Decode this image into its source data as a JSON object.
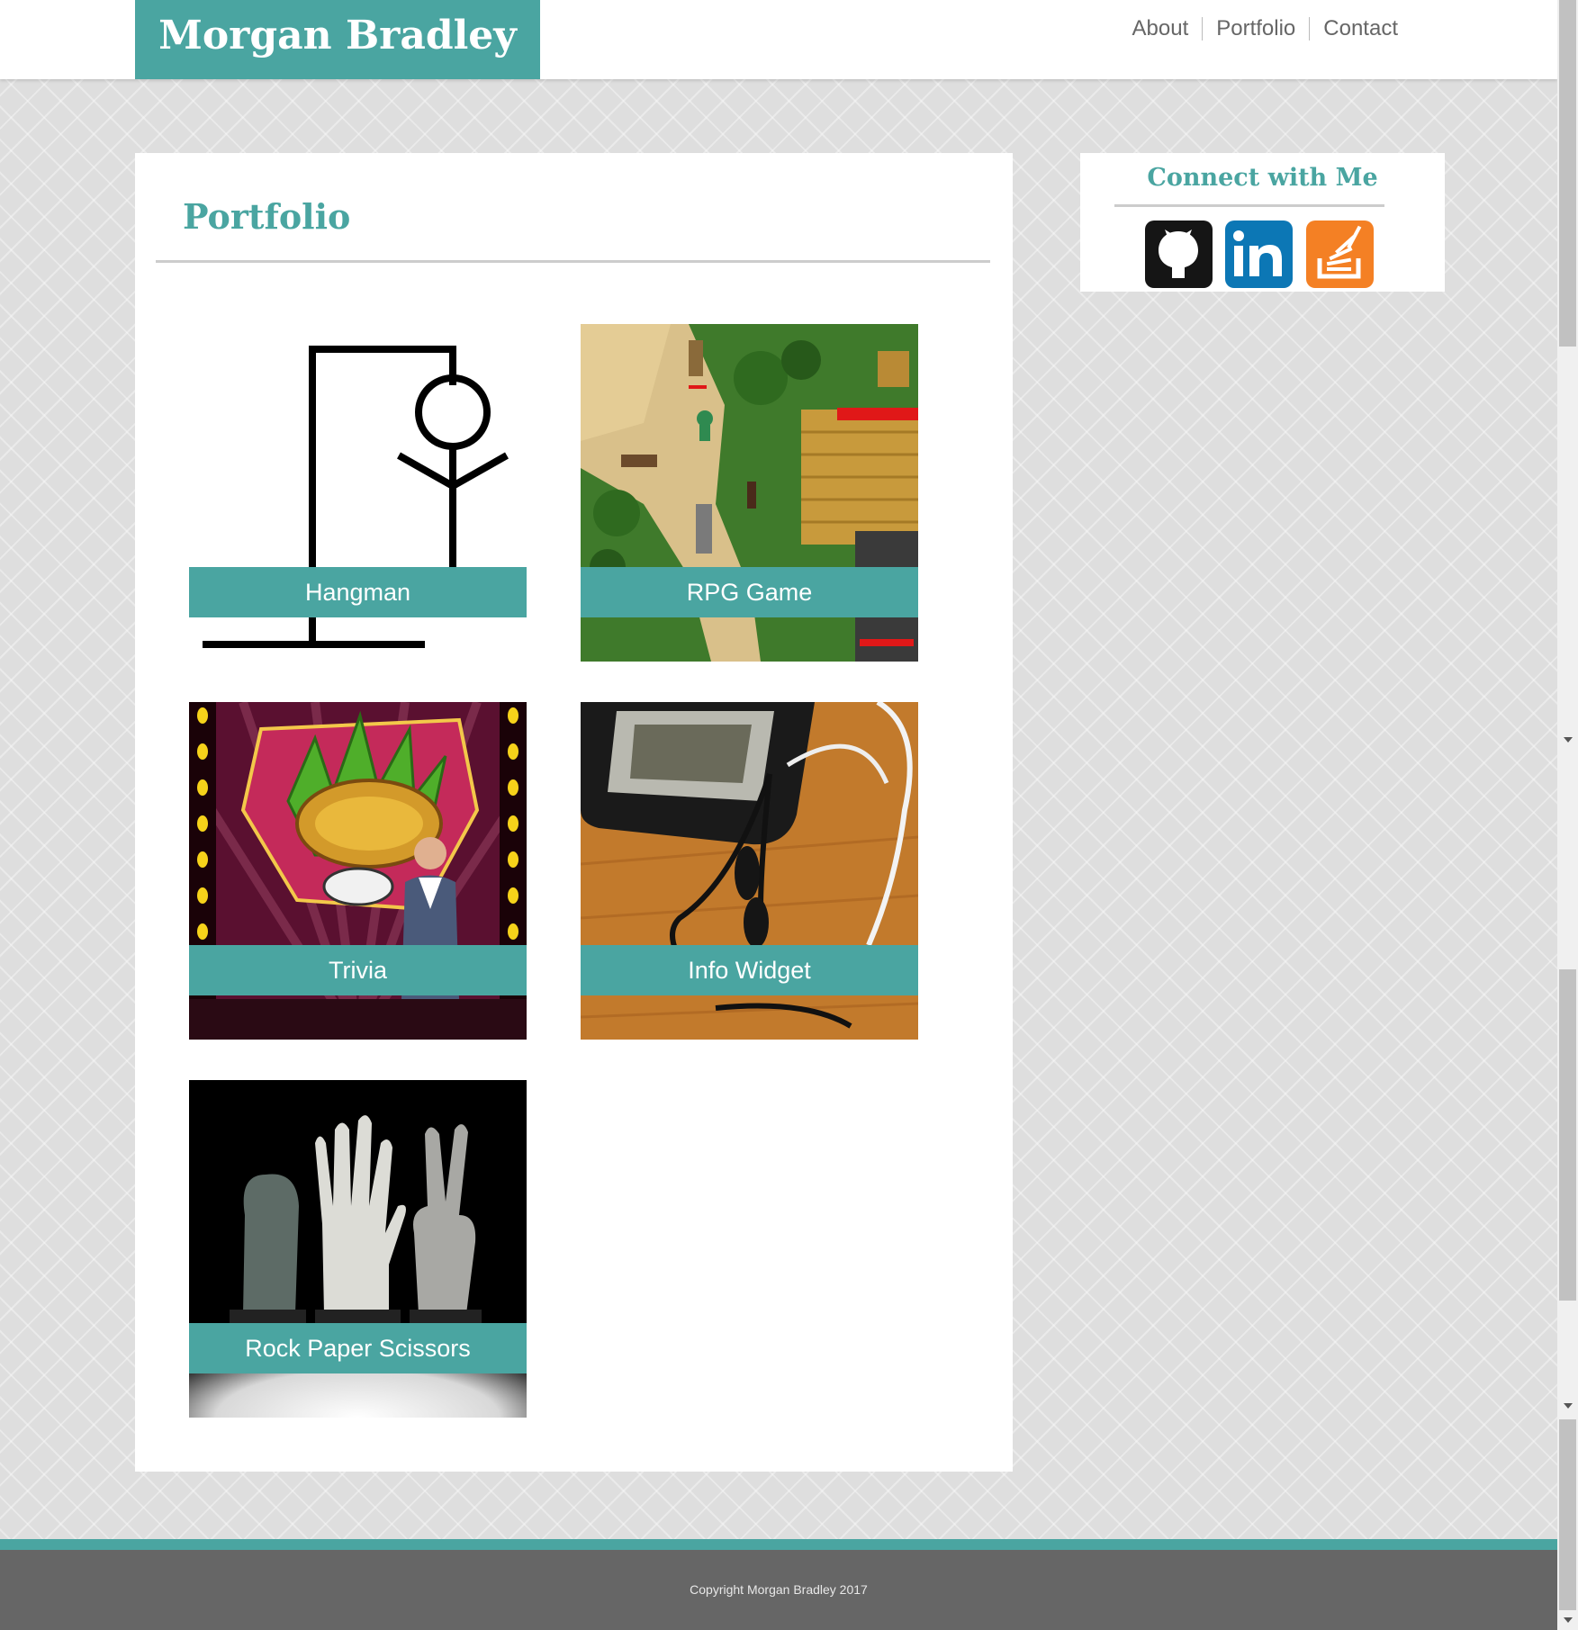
{
  "header": {
    "brand": "Morgan Bradley",
    "nav": [
      "About",
      "Portfolio",
      "Contact"
    ]
  },
  "main": {
    "title": "Portfolio",
    "projects": [
      {
        "title": "Hangman",
        "image": "hangman-drawing"
      },
      {
        "title": "RPG Game",
        "image": "rpg-game-screenshot"
      },
      {
        "title": "Trivia",
        "image": "trivia-game-logo"
      },
      {
        "title": "Info Widget",
        "image": "phone-earbuds-photo"
      },
      {
        "title": "Rock Paper Scissors",
        "image": "hand-statues-photo"
      }
    ]
  },
  "sidebar": {
    "title": "Connect with Me",
    "links": [
      {
        "icon": "github-icon",
        "color": "#151515"
      },
      {
        "icon": "linkedin-icon",
        "color": "#0c77b5"
      },
      {
        "icon": "stackoverflow-icon",
        "color": "#f48024"
      }
    ]
  },
  "footer": {
    "copyright": "Copyright Morgan Bradley 2017"
  },
  "colors": {
    "accent": "#4aa5a1",
    "footer": "#666666"
  }
}
